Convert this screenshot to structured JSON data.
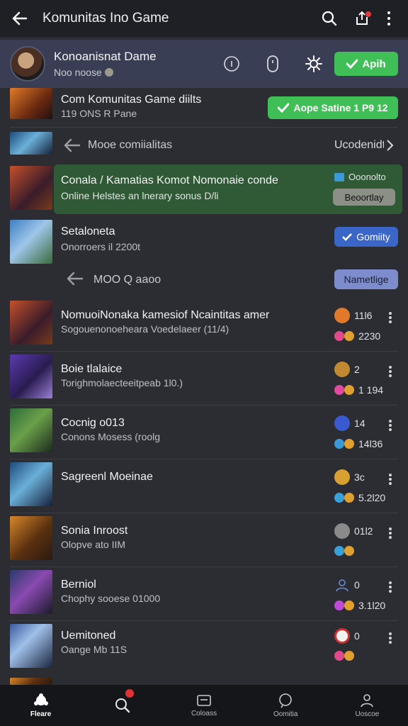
{
  "appbar": {
    "title": "Komunitas Ino Game"
  },
  "profile": {
    "name": "Konoanisnat Dame",
    "sub": "Noo noose",
    "apply_label": "Apih"
  },
  "rows": {
    "r1": {
      "title": "Com Komunitas Game diilts",
      "sub": "119 ONS R Pane",
      "pill": "Aope Satine 1 P9 12"
    },
    "r2": {
      "title": "Mooe comiialitas",
      "right": "Ucodenidt"
    },
    "r3": {
      "title": "Conala / Kamatias Komot Nomonaie conde",
      "sub": "Online  Helstes an lnerary sonus D/li",
      "tag": "Ooonolto",
      "pill": "Beoortlay"
    },
    "r4": {
      "title": "Setaloneta",
      "sub": "Onorroers il 2200t",
      "pill": "Gomiity"
    },
    "r5": {
      "title": "MOO Q aaoo",
      "pill": "Nametlige"
    },
    "r6": {
      "title": "NomuoiNonaka kamesiof Ncaintitas amer",
      "sub": "Sogouenonoeheara Voedelaeer (11/4)",
      "stat1": "11l6",
      "stat2": "2230"
    },
    "r7": {
      "title": "Boie tlalaice",
      "sub": "Torighmolaecteeitpeab 1l0.)",
      "stat1": "2",
      "stat2": "1 194"
    },
    "r8": {
      "title": "Cocnig o013",
      "sub": "Conons Mosess (roolg",
      "stat1": "14",
      "stat2": "14l36"
    },
    "r9": {
      "title": "Sagreenl Moeinae",
      "sub": "",
      "stat1": "3c",
      "stat2": "5.2l20"
    },
    "r10": {
      "title": "Sonia Inroost",
      "sub": "Olopve ato IIM",
      "stat1": "01l2",
      "stat2": ""
    },
    "r11": {
      "title": "Berniol",
      "sub": "Chophy sooese 01000",
      "stat1": "0",
      "stat2": "3.1l20"
    },
    "r12": {
      "title": "Uemitoned",
      "sub": "Oange Mb 11S",
      "stat1": "0",
      "stat2": ""
    }
  },
  "bottomnav": [
    {
      "label": "Fleare"
    },
    {
      "label": ""
    },
    {
      "label": "Coloass"
    },
    {
      "label": "Oomitia"
    },
    {
      "label": "Uoscoe"
    }
  ],
  "colors": {
    "accent_green": "#3fbf55",
    "accent_blue": "#3a66c8",
    "bg": "#2b2d33"
  }
}
